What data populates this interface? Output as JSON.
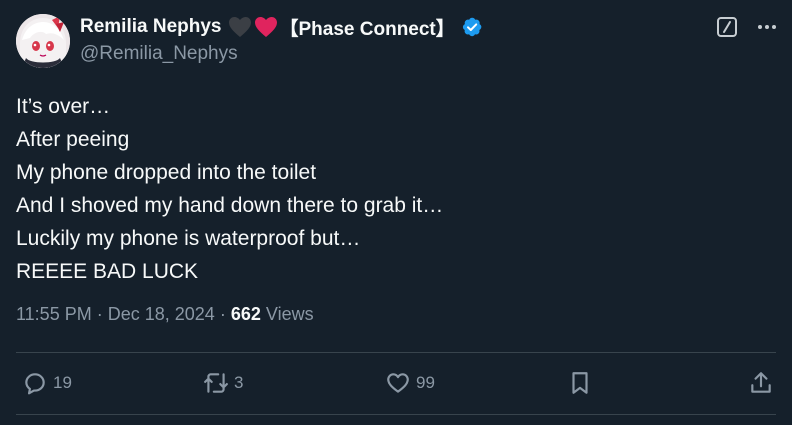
{
  "author": {
    "display_name": "Remilia Nephys",
    "name_suffix": "【Phase Connect】",
    "handle": "@Remilia_Nephys",
    "verified": true,
    "avatar_icon": "anime-character-avatar",
    "heart_emojis": [
      "black-heart-emoji",
      "red-heart-emoji"
    ]
  },
  "post": {
    "lines": [
      "It’s over…",
      "After peeing",
      "My phone dropped into the toilet",
      "And I shoved my hand down there to grab it…",
      "Luckily my phone is waterproof but…",
      "REEEE BAD LUCK"
    ]
  },
  "meta": {
    "time": "11:55 PM",
    "date": "Dec 18, 2024",
    "views_count": "662",
    "views_label": "Views"
  },
  "actions": {
    "reply_count": "19",
    "retweet_count": "3",
    "like_count": "99",
    "reply_icon": "reply-icon",
    "retweet_icon": "retweet-icon",
    "like_icon": "heart-icon",
    "bookmark_icon": "bookmark-icon",
    "share_icon": "share-icon"
  },
  "colors": {
    "background": "#15202b",
    "text": "#f7f9f9",
    "muted": "#8b98a5",
    "verified": "#1d9bf0",
    "divider": "#38444d",
    "red_heart": "#e0245e"
  }
}
